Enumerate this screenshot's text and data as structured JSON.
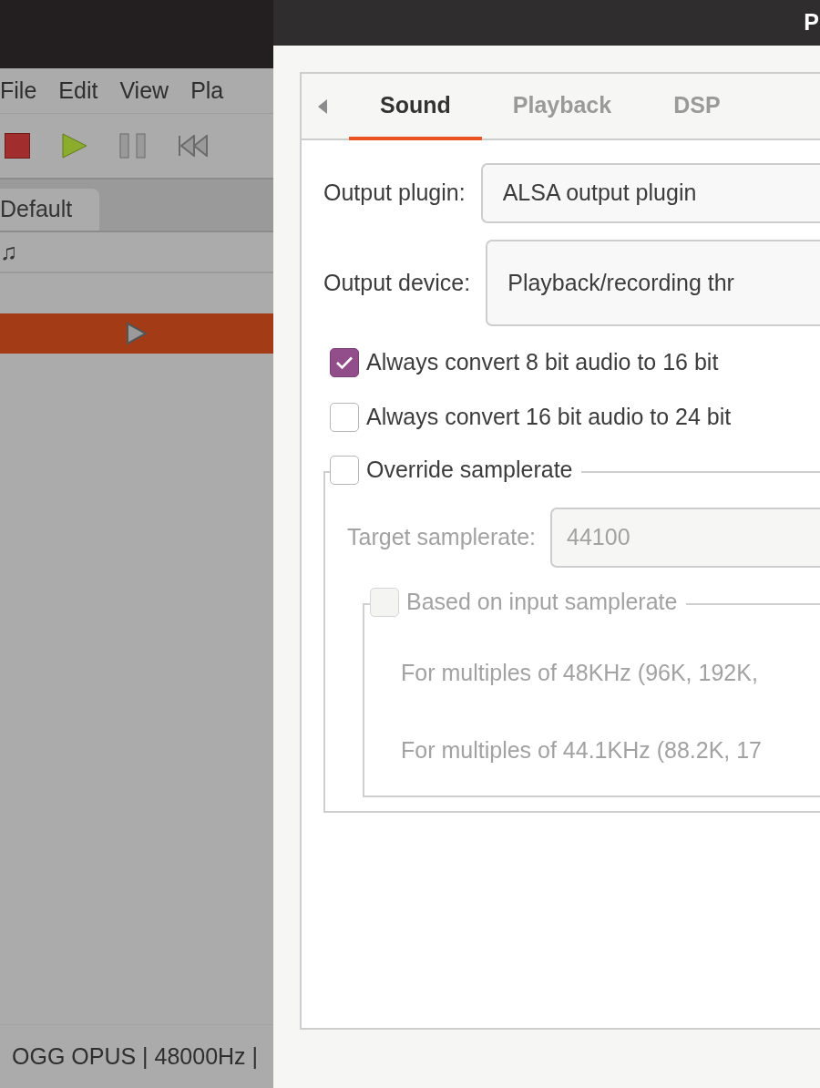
{
  "player": {
    "menu": [
      "File",
      "Edit",
      "View",
      "Pla"
    ],
    "playlist_tabs": [
      {
        "label": "Default",
        "selected": true
      }
    ],
    "column_header": "♫",
    "rows": [
      {
        "selected": true,
        "playing": true
      }
    ],
    "status": "OGG OPUS | 48000Hz |"
  },
  "dialog": {
    "title": "P",
    "tabs": [
      {
        "label": "Sound",
        "selected": true
      },
      {
        "label": "Playback",
        "selected": false
      },
      {
        "label": "DSP",
        "selected": false
      }
    ],
    "output_plugin": {
      "label": "Output plugin:",
      "value": "ALSA output plugin"
    },
    "output_device": {
      "label": "Output device:",
      "value": "Playback/recording thr"
    },
    "checkboxes": [
      {
        "label": "Always convert 8 bit audio to 16 bit",
        "checked": true
      },
      {
        "label": "Always convert 16 bit audio to 24 bit",
        "checked": false
      }
    ],
    "override": {
      "label": "Override samplerate",
      "checked": false,
      "target": {
        "label": "Target samplerate:",
        "value": "44100",
        "disabled": true
      },
      "based": {
        "label": "Based on input samplerate",
        "checked": false,
        "disabled": true
      },
      "notes": [
        {
          "text": "For multiples of 48KHz (96K, 192K,",
          "disabled": true
        },
        {
          "text": "For multiples of 44.1KHz (88.2K, 17",
          "disabled": true
        }
      ]
    }
  }
}
